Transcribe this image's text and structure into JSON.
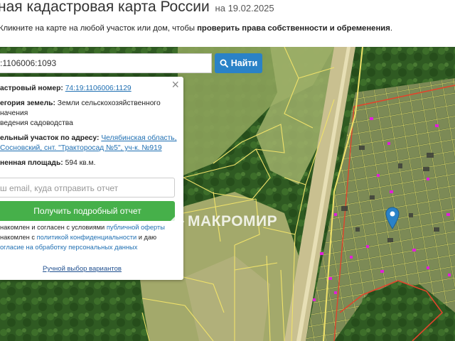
{
  "header": {
    "title": "ная кадастровая карта России",
    "date": "на 19.02.2025",
    "instruction_prefix": "Кликните на карте на любой участок или дом, чтобы ",
    "instruction_bold": "проверить права собственности и обременения",
    "instruction_suffix": "."
  },
  "search": {
    "value": ":1106006:1093",
    "button_label": "Найти"
  },
  "card": {
    "cadastral_label": "астровый номер:",
    "cadastral_value": "74:19:1106006:1129",
    "category_label": "егория земель:",
    "category_value_line1": "Земли сельскохозяйственного",
    "category_value_line2": "начения",
    "category_value_line3": "ведения садоводства",
    "address_label": "ельный участок по адресу:",
    "address_value_line1": "Челябинская область,",
    "address_value_line2": "Сосновский, снт. \"Тракторосад №5\", уч-к. №919",
    "area_label": "ненная площадь:",
    "area_value": "594 кв.м.",
    "email_placeholder": "ш email, куда отправить отчет",
    "report_button": "Получить подробный отчет",
    "consent_line1_prefix": "накомлен и согласен с условиями ",
    "consent_line1_link": "публичной оферты",
    "consent_line2_prefix": "накомлен с ",
    "consent_line2_link": "политикой конфиденциальности",
    "consent_line2_suffix": " и даю",
    "consent_line3_link": "огласие на обработку персональных данных",
    "manual_link": "Ручной выбор вариантов"
  },
  "watermark": {
    "text": "МАКРОМИР"
  },
  "colors": {
    "accent_blue": "#2a82c7",
    "report_green": "#46b04a",
    "parcel_border": "#f0e26a",
    "plot_border_red": "#e0452c",
    "plot_fill_magenta": "#e020d8"
  },
  "icons": [
    "search-icon",
    "close-icon",
    "map-pin-icon",
    "watermark-logo-icon"
  ]
}
